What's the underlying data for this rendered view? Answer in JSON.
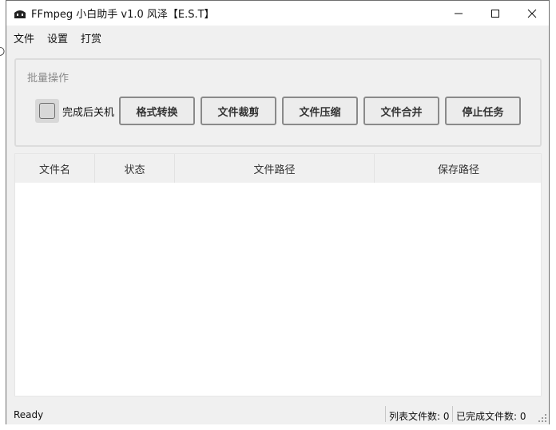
{
  "window": {
    "title": "FFmpeg 小白助手 v1.0 风泽【E.S.T】",
    "controls": {
      "minimize_icon": "minimize-icon",
      "maximize_icon": "maximize-icon",
      "close_icon": "close-icon"
    }
  },
  "menu": {
    "items": [
      {
        "label": "文件"
      },
      {
        "label": "设置"
      },
      {
        "label": "打赏"
      }
    ]
  },
  "batch": {
    "group_title": "批量操作",
    "shutdown_checkbox": {
      "label": "完成后关机",
      "checked": false
    },
    "buttons": [
      {
        "label": "格式转换"
      },
      {
        "label": "文件裁剪"
      },
      {
        "label": "文件压缩"
      },
      {
        "label": "文件合并"
      },
      {
        "label": "停止任务"
      }
    ]
  },
  "table": {
    "columns": [
      "文件名",
      "状态",
      "文件路径",
      "保存路径"
    ],
    "rows": []
  },
  "status": {
    "ready": "Ready",
    "list_count": "列表文件数: 0",
    "done_count": "已完成文件数: 0"
  }
}
